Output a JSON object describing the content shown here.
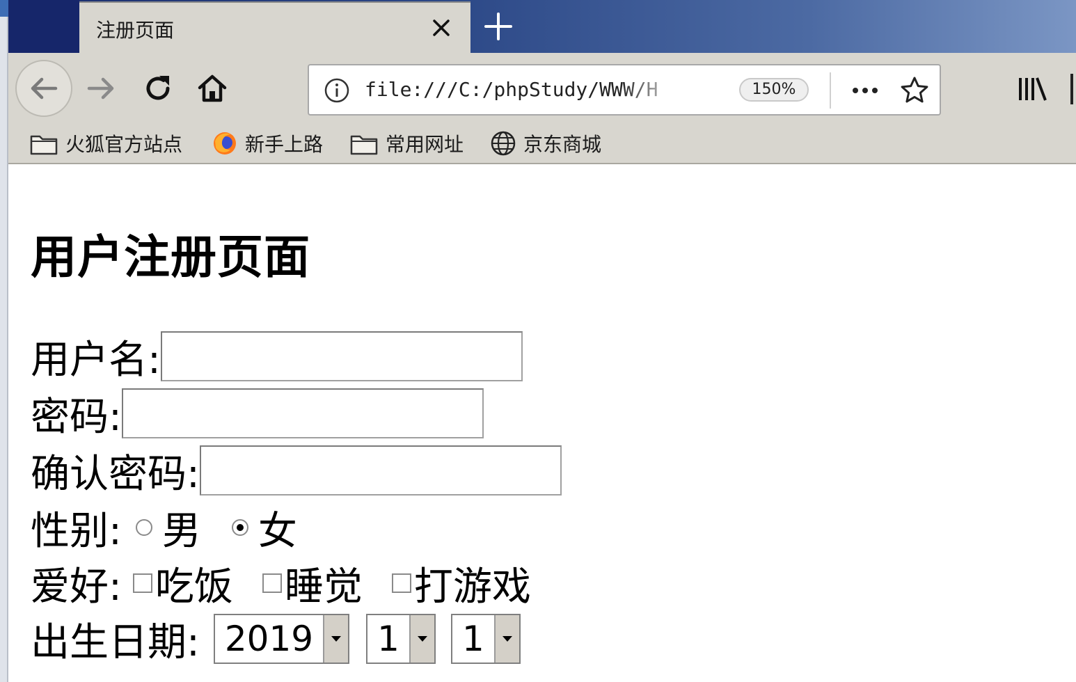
{
  "tab": {
    "title": "注册页面"
  },
  "navbar": {
    "url": "file:///C:/phpStudy/WWW/H",
    "zoom": "150%"
  },
  "bookmarks": [
    {
      "label": "火狐官方站点",
      "icon": "folder-icon"
    },
    {
      "label": "新手上路",
      "icon": "firefox-icon"
    },
    {
      "label": "常用网址",
      "icon": "folder-icon"
    },
    {
      "label": "京东商城",
      "icon": "globe-icon"
    }
  ],
  "form": {
    "title": "用户注册页面",
    "username_label": "用户名:",
    "password_label": "密码:",
    "confirm_label": "确认密码:",
    "gender_label": "性别:",
    "gender_options": [
      "男",
      "女"
    ],
    "gender_selected": "女",
    "hobby_label": "爱好:",
    "hobbies": [
      "吃饭",
      "睡觉",
      "打游戏"
    ],
    "birthday_label": "出生日期:",
    "birthday": {
      "year": "2019",
      "month": "1",
      "day": "1"
    }
  }
}
